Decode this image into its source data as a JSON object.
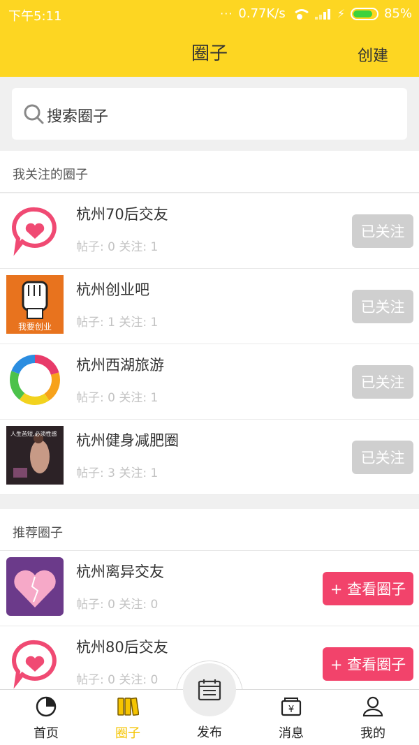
{
  "status": {
    "time": "下午5:11",
    "dots": "···",
    "speed": "0.77K/s",
    "battery": "85%"
  },
  "header": {
    "title": "圈子",
    "create": "创建"
  },
  "search": {
    "placeholder": "搜索圈子"
  },
  "followed_section": {
    "title": "我关注的圈子",
    "button_label": "已关注",
    "items": [
      {
        "name": "杭州70后交友",
        "meta": "帖子: 0 关注: 1",
        "icon": "heart-bubble-icon"
      },
      {
        "name": "杭州创业吧",
        "meta": "帖子: 1 关注: 1",
        "icon": "startup-fist-image",
        "image_text": "我要创业"
      },
      {
        "name": "杭州西湖旅游",
        "meta": "帖子: 0 关注: 1",
        "icon": "rainbow-ring-logo"
      },
      {
        "name": "杭州健身减肥圈",
        "meta": "帖子: 3 关注: 1",
        "icon": "fitness-photo",
        "image_text": "人生苦短,必须性感"
      }
    ]
  },
  "recommended_section": {
    "title": "推荐圈子",
    "button_label": "+ 查看圈子",
    "items": [
      {
        "name": "杭州离异交友",
        "meta": "帖子: 0 关注: 0",
        "icon": "broken-heart-image"
      },
      {
        "name": "杭州80后交友",
        "meta": "帖子: 0 关注: 0",
        "icon": "heart-bubble-icon"
      }
    ]
  },
  "tabbar": {
    "items": [
      {
        "label": "首页",
        "icon": "pie-chart-icon"
      },
      {
        "label": "圈子",
        "icon": "books-icon",
        "active": true
      },
      {
        "label": "发布",
        "icon": "calendar-publish-icon"
      },
      {
        "label": "消息",
        "icon": "yen-message-icon"
      },
      {
        "label": "我的",
        "icon": "user-icon"
      }
    ]
  },
  "colors": {
    "brand_yellow": "#fdd622",
    "accent_pink": "#f2436b",
    "followed_gray": "#cfcfcf",
    "active_tab": "#f5c400"
  }
}
